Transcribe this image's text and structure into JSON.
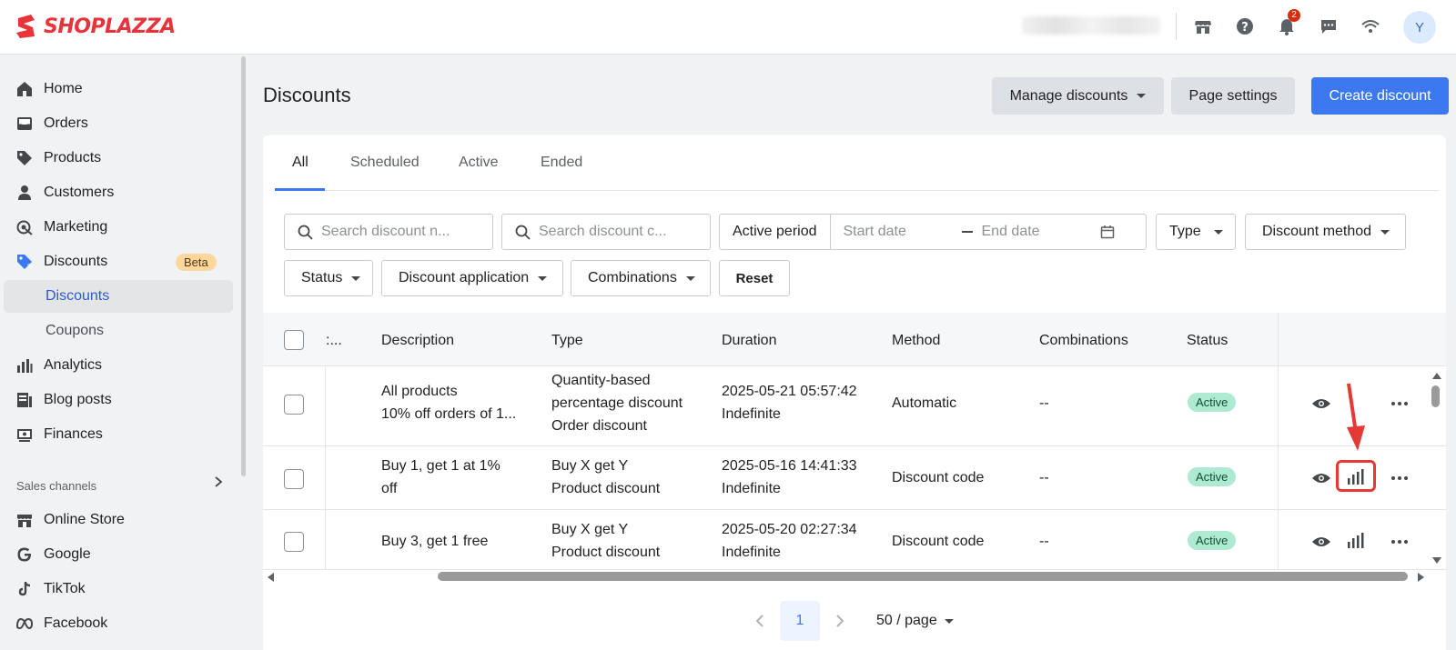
{
  "brand": {
    "name": "SHOPLAZZA",
    "color": "#e8333a"
  },
  "topbar": {
    "notifications_count": "2",
    "avatar_initial": "Y",
    "icons": [
      "store-icon",
      "help-icon",
      "bell-icon",
      "chat-icon",
      "wifi-icon"
    ]
  },
  "sidebar": {
    "items": [
      {
        "label": "Home",
        "icon": "home-icon"
      },
      {
        "label": "Orders",
        "icon": "orders-icon"
      },
      {
        "label": "Products",
        "icon": "tag-icon"
      },
      {
        "label": "Customers",
        "icon": "person-icon"
      },
      {
        "label": "Marketing",
        "icon": "marketing-icon"
      },
      {
        "label": "Discounts",
        "icon": "discount-icon",
        "badge": "Beta"
      },
      {
        "label": "Analytics",
        "icon": "analytics-icon"
      },
      {
        "label": "Blog posts",
        "icon": "blog-icon"
      },
      {
        "label": "Finances",
        "icon": "finances-icon"
      }
    ],
    "sub_items": [
      {
        "label": "Discounts",
        "active": true
      },
      {
        "label": "Coupons",
        "active": false
      }
    ],
    "sales_channels_title": "Sales channels",
    "channels": [
      {
        "label": "Online Store",
        "icon": "store-icon"
      },
      {
        "label": "Google",
        "icon": "google-icon"
      },
      {
        "label": "TikTok",
        "icon": "tiktok-icon"
      },
      {
        "label": "Facebook",
        "icon": "meta-icon"
      }
    ]
  },
  "page": {
    "title": "Discounts",
    "manage_label": "Manage discounts",
    "page_settings_label": "Page settings",
    "create_label": "Create discount"
  },
  "tabs": [
    "All",
    "Scheduled",
    "Active",
    "Ended"
  ],
  "filters": {
    "search_name_placeholder": "Search discount n...",
    "search_code_placeholder": "Search discount c...",
    "active_period_label": "Active period",
    "start_date_placeholder": "Start date",
    "end_date_placeholder": "End date",
    "type_label": "Type",
    "discount_method_label": "Discount method",
    "status_label": "Status",
    "discount_application_label": "Discount application",
    "combinations_label": "Combinations",
    "reset_label": "Reset"
  },
  "table": {
    "headers": [
      ":...",
      "Description",
      "Type",
      "Duration",
      "Method",
      "Combinations",
      "Status"
    ],
    "rows": [
      {
        "description": [
          "All products",
          "10% off orders of 1..."
        ],
        "type": [
          "Quantity-based",
          "percentage discount",
          "Order discount"
        ],
        "duration": [
          "2025-05-21 05:57:42",
          "Indefinite"
        ],
        "method": "Automatic",
        "combinations": "--",
        "status": "Active"
      },
      {
        "description": [
          "Buy 1, get 1 at 1%",
          "off"
        ],
        "type": [
          "Buy X get Y",
          "Product discount"
        ],
        "duration": [
          "2025-05-16 14:41:33",
          "Indefinite"
        ],
        "method": "Discount code",
        "combinations": "--",
        "status": "Active"
      },
      {
        "description": [
          "Buy 3, get 1 free"
        ],
        "type": [
          "Buy X get Y",
          "Product discount"
        ],
        "duration": [
          "2025-05-20 02:27:34",
          "Indefinite"
        ],
        "method": "Discount code",
        "combinations": "--",
        "status": "Active"
      }
    ]
  },
  "pagination": {
    "current_page": "1",
    "page_size_label": "50 / page"
  },
  "colors": {
    "accent": "#3c79f0",
    "active_badge": "#aee9d1",
    "annotation": "#e53935"
  }
}
